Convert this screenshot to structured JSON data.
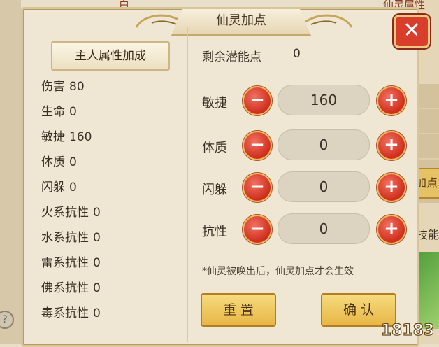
{
  "background": {
    "top_text_left": "白",
    "top_text_right": "仙灵属性",
    "right_button_label": "加点",
    "right_text": "技能",
    "help_icon": "?"
  },
  "dialog": {
    "title": "仙灵加点",
    "close_icon": "✕"
  },
  "left_panel": {
    "header": "主人属性加成",
    "stats": [
      {
        "label": "伤害",
        "value": "80"
      },
      {
        "label": "生命",
        "value": "0"
      },
      {
        "label": "敏捷",
        "value": "160"
      },
      {
        "label": "体质",
        "value": "0"
      },
      {
        "label": "闪躲",
        "value": "0"
      },
      {
        "label": "火系抗性",
        "value": "0"
      },
      {
        "label": "水系抗性",
        "value": "0"
      },
      {
        "label": "雷系抗性",
        "value": "0"
      },
      {
        "label": "佛系抗性",
        "value": "0"
      },
      {
        "label": "毒系抗性",
        "value": "0"
      }
    ]
  },
  "right_panel": {
    "remaining_label": "剩余潜能点",
    "remaining_value": "0",
    "attributes": [
      {
        "label": "敏捷",
        "value": "160"
      },
      {
        "label": "体质",
        "value": "0"
      },
      {
        "label": "闪躲",
        "value": "0"
      },
      {
        "label": "抗性",
        "value": "0"
      }
    ],
    "minus_symbol": "−",
    "plus_symbol": "+",
    "hint": "*仙灵被唤出后，仙灵加点才会生效",
    "reset_label": "重 置",
    "confirm_label": "确 认"
  },
  "watermark": "18183",
  "colors": {
    "panel_bg": "#efe6d3",
    "button_red": "#d93e2c",
    "button_gold": "#e8b645"
  }
}
